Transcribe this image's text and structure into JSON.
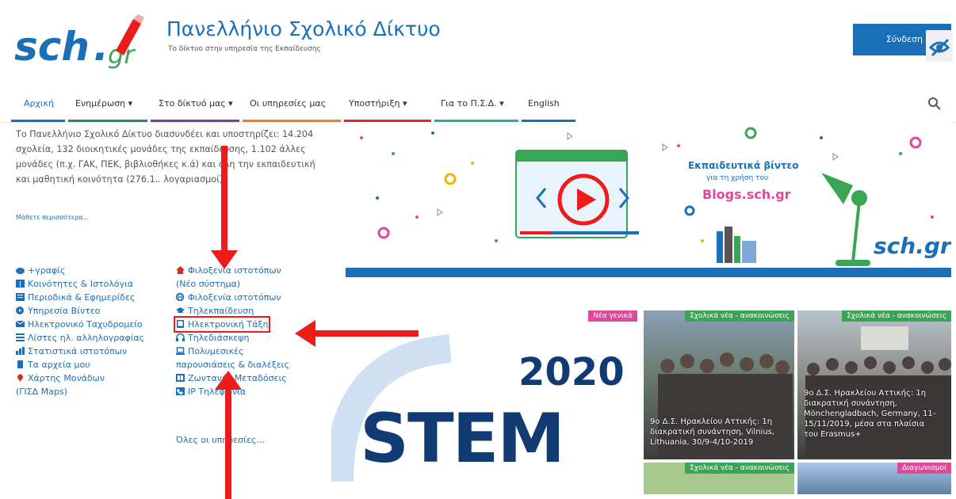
{
  "header": {
    "title": "Πανελλήνιο Σχολικό Δίκτυο",
    "subtitle": "Το δίκτυο στην υπηρεσία της Εκπαίδευσης",
    "login_label": "Σύνδεση",
    "logo_text": "sch.gr"
  },
  "nav": {
    "items": [
      {
        "label": "Αρχική"
      },
      {
        "label": "Ενημέρωση ▾"
      },
      {
        "label": "Στο δίκτυό μας ▾"
      },
      {
        "label": "Οι υπηρεσίες μας"
      },
      {
        "label": "Υποστήριξη ▾"
      },
      {
        "label": "Για το Π.Σ.Δ. ▾"
      },
      {
        "label": "English"
      }
    ],
    "colors": [
      "#1b6fb8",
      "#2e8b57",
      "#7b3f98",
      "#e08a1e",
      "#d62b2b",
      "#2ba6a6",
      "#1b6fb8"
    ]
  },
  "intro": {
    "text": "Το Πανελλήνιο Σχολικό Δίκτυο διασυνδέει και υποστηρίζει: 14.204 σχολεία, 132 διοικητικές μονάδες της εκπαίδευσης, 1.102 άλλες μονάδες (π.χ. ΓΑΚ, ΠΕΚ, βιβλιοθήκες κ.ά) και όλη την εκπαιδευτική και μαθητική κοινότητα (276.1.. λογαριασμοί).",
    "learn_more": "Μάθετε περισσότερα..."
  },
  "services_left": [
    {
      "label": "+γραφίς",
      "icon": "cloud-icon"
    },
    {
      "label": "Κοινότητες & Ιστολόγια",
      "icon": "columns-icon"
    },
    {
      "label": "Περιοδικά & Εφημερίδες",
      "icon": "newspaper-icon"
    },
    {
      "label": "Υπηρεσία Βίντεο",
      "icon": "play-circle-icon"
    },
    {
      "label": "Ηλεκτρονικό Ταχυδρομείο",
      "icon": "envelope-icon"
    },
    {
      "label": "Λίστες ηλ. αλληλογραφίας",
      "icon": "list-icon"
    },
    {
      "label": "Στατιστικά ιστοτόπων",
      "icon": "bar-chart-icon"
    },
    {
      "label": "Τα αρχεία μου",
      "icon": "file-icon"
    },
    {
      "label": "Χάρτης Μονάδων",
      "icon": "map-pin-icon"
    },
    {
      "label": "(ΓΙΣΔ Maps)",
      "icon": ""
    }
  ],
  "services_right": [
    {
      "label": "Φιλοξενία ιστοτόπων",
      "icon": "home-icon"
    },
    {
      "label": "(Νέο σύστημα)",
      "icon": ""
    },
    {
      "label": "Φιλοξενία ιστοτόπων",
      "icon": "globe-icon"
    },
    {
      "label": "Τηλεκπαίδευση",
      "icon": "graduation-cap-icon"
    },
    {
      "label": "Ηλεκτρονική Τάξη",
      "icon": "tablet-icon"
    },
    {
      "label": "Τηλεδιάσκεψη",
      "icon": "headphones-icon"
    },
    {
      "label": "Πολυμεσικές",
      "icon": "laptop-icon"
    },
    {
      "label": "παρουσιάσεις & διαλέξεις",
      "icon": ""
    },
    {
      "label": "Ζωντανές Μεταδόσεις",
      "icon": "broadcast-icon"
    },
    {
      "label": "IP Τηλεφωνία",
      "icon": "phone-icon"
    },
    {
      "label": "Όλες οι υπηρεσίες...",
      "icon": ""
    }
  ],
  "banner": {
    "title": "Εκπαιδευτικά βίντεο",
    "subtitle": "για τη χρήση του",
    "site": "Blogs.sch.gr",
    "logo_text": "sch.gr"
  },
  "news": {
    "stem_year": "2020",
    "stem_word": "STEM",
    "stem_tag": "Νέα γενικά",
    "tile1_tag": "Σχολικά νέα - ανακοινώσεις",
    "tile1_caption": "9ο Δ.Σ. Ηρακλείου Αττικής: 1η διακρατική συνάντηση, Vilnius, Lithuania, 30/9-4/10-2019",
    "tile2_tag": "Σχολικά νέα - ανακοινώσεις",
    "tile2_caption": "9ο Δ.Σ. Ηρακλείου Αττικής: 1η διακρατική συνάντηση, Mönchengladbach, Germany, 11-15/11/2019, μέσα στα πλαίσια του Erasmus+",
    "tile3_tag": "Σχολικά νέα - ανακοινώσεις",
    "tile4_tag": "Διαγωνισμοί"
  },
  "colors": {
    "brand": "#1b6fb8",
    "green": "#3aa655",
    "highlight": "#ee1b1b",
    "pink": "#e2489a"
  }
}
